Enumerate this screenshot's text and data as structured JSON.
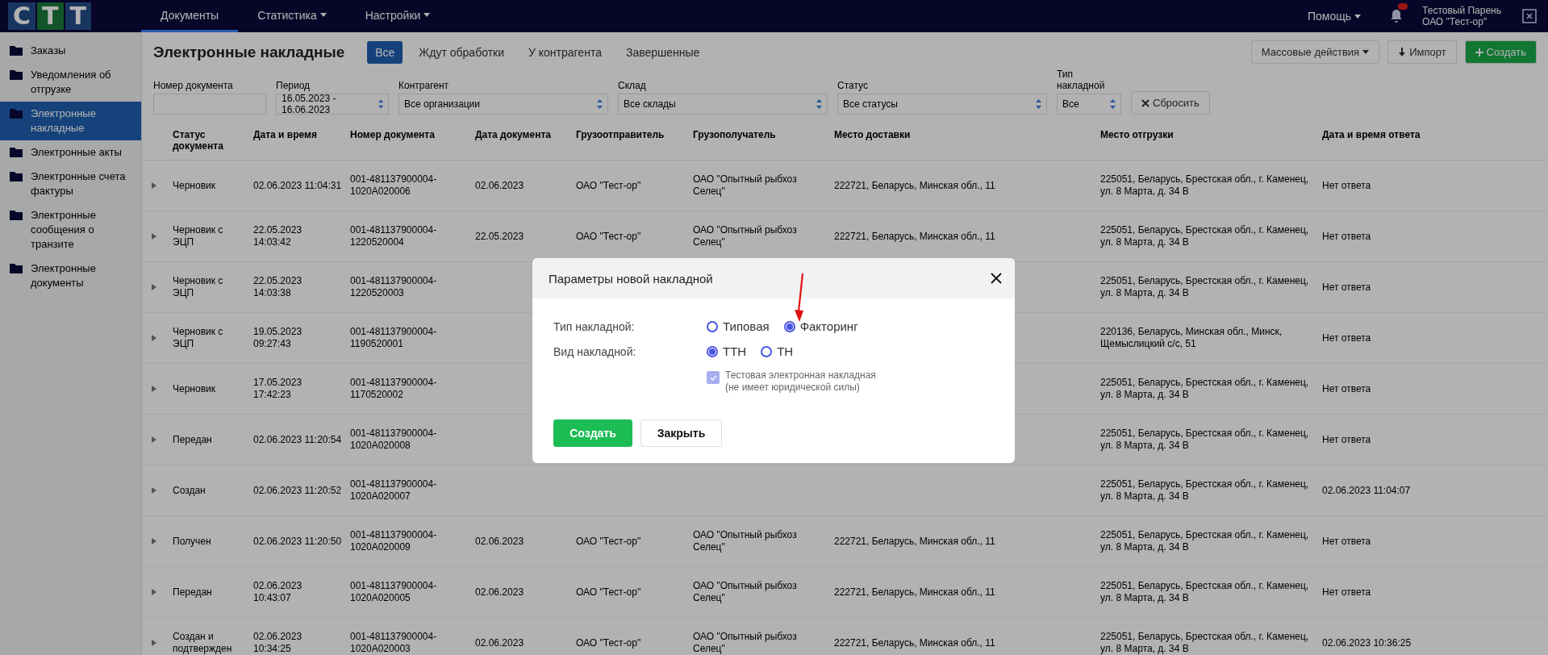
{
  "topbar": {
    "logo": [
      "С",
      "Т",
      "Т"
    ],
    "nav": [
      {
        "label": "Документы",
        "selected": true,
        "dropdown": false
      },
      {
        "label": "Статистика",
        "selected": false,
        "dropdown": true
      },
      {
        "label": "Настройки",
        "selected": false,
        "dropdown": true
      }
    ],
    "help": "Помощь",
    "user": {
      "name": "Тестовый Парень",
      "org": "ОАО \"Тест-ор\""
    }
  },
  "sidebar": {
    "items": [
      {
        "label": "Заказы",
        "selected": false
      },
      {
        "label": "Уведомления об отгрузке",
        "selected": false
      },
      {
        "label": "Электронные накладные",
        "selected": true
      },
      {
        "label": "Электронные акты",
        "selected": false
      },
      {
        "label": "Электронные счета фактуры",
        "selected": false
      },
      {
        "label": "Электронные сообщения о транзите",
        "selected": false
      },
      {
        "label": "Электронные документы",
        "selected": false
      }
    ]
  },
  "header": {
    "title": "Электронные накладные",
    "tabs": [
      {
        "label": "Все",
        "selected": true
      },
      {
        "label": "Ждут обработки",
        "selected": false
      },
      {
        "label": "У контрагента",
        "selected": false
      },
      {
        "label": "Завершенные",
        "selected": false
      }
    ],
    "mass_actions": "Массовые действия",
    "import": "Импорт",
    "create": "Создать"
  },
  "filters": [
    {
      "label": "Номер документа",
      "kind": "input"
    },
    {
      "label": "Период",
      "value": "16.05.2023 - 16.06.2023",
      "kind": "select"
    },
    {
      "label": "Контрагент",
      "value": "Все организации",
      "kind": "select"
    },
    {
      "label": "Склад",
      "value": "Все склады",
      "kind": "select"
    },
    {
      "label": "Статус",
      "value": "Все статусы",
      "kind": "select"
    },
    {
      "label": "Тип накладной",
      "value": "Все",
      "kind": "select"
    }
  ],
  "reset": "Сбросить",
  "table": {
    "columns": [
      "Статус документа",
      "Дата и время",
      "Номер документа",
      "Дата документа",
      "Грузоотправитель",
      "Грузополучатель",
      "Место доставки",
      "Место отгрузки",
      "Дата и время ответа"
    ],
    "rows": [
      {
        "status": "Черновик",
        "datetime": "02.06.2023 11:04:31",
        "number": "001-481137900004-1020А020006",
        "doc_date": "02.06.2023",
        "sender": "ОАО \"Тест-ор\"",
        "recipient": "ОАО \"Опытный рыбхоз Селец\"",
        "delivery": "222721, Беларусь, Минская обл., 11",
        "shipping": "225051, Беларусь, Брестская обл., г. Каменец, ул. 8 Марта, д. 34 В",
        "reply": "Нет ответа"
      },
      {
        "status": "Черновик с ЭЦП",
        "datetime": "22.05.2023 14:03:42",
        "number": "001-481137900004-1220520004",
        "doc_date": "22.05.2023",
        "sender": "ОАО \"Тест-ор\"",
        "recipient": "ОАО \"Опытный рыбхоз Селец\"",
        "delivery": "222721, Беларусь, Минская обл., 11",
        "shipping": "225051, Беларусь, Брестская обл., г. Каменец, ул. 8 Марта, д. 34 В",
        "reply": "Нет ответа"
      },
      {
        "status": "Черновик с ЭЦП",
        "datetime": "22.05.2023 14:03:38",
        "number": "001-481137900004-1220520003",
        "shipping": "225051, Беларусь, Брестская обл., г. Каменец, ул. 8 Марта, д. 34 В",
        "reply": "Нет ответа"
      },
      {
        "status": "Черновик с ЭЦП",
        "datetime": "19.05.2023 09:27:43",
        "number": "001-481137900004-1190520001",
        "shipping": "220136, Беларусь, Минская обл., Минск, Щемыслицкий с/с, 51",
        "reply": "Нет ответа"
      },
      {
        "status": "Черновик",
        "datetime": "17.05.2023 17:42:23",
        "number": "001-481137900004-1170520002",
        "shipping": "225051, Беларусь, Брестская обл., г. Каменец, ул. 8 Марта, д. 34 В",
        "reply": "Нет ответа"
      },
      {
        "status": "Передан",
        "datetime": "02.06.2023 11:20:54",
        "number": "001-481137900004-1020А020008",
        "shipping": "225051, Беларусь, Брестская обл., г. Каменец, ул. 8 Марта, д. 34 В",
        "reply": "Нет ответа"
      },
      {
        "status": "Создан",
        "datetime": "02.06.2023 11:20:52",
        "number": "001-481137900004-1020А020007",
        "shipping": "225051, Беларусь, Брестская обл., г. Каменец, ул. 8 Марта, д. 34 В",
        "reply": "02.06.2023 11:04:07"
      },
      {
        "status": "Получен",
        "datetime": "02.06.2023 11:20:50",
        "number": "001-481137900004-1020А020009",
        "doc_date": "02.06.2023",
        "sender": "ОАО \"Тест-ор\"",
        "recipient": "ОАО \"Опытный рыбхоз Селец\"",
        "delivery": "222721, Беларусь, Минская обл., 11",
        "shipping": "225051, Беларусь, Брестская обл., г. Каменец, ул. 8 Марта, д. 34 В",
        "reply": "Нет ответа"
      },
      {
        "status": "Передан",
        "datetime": "02.06.2023 10:43:07",
        "number": "001-481137900004-1020А020005",
        "doc_date": "02.06.2023",
        "sender": "ОАО \"Тест-ор\"",
        "recipient": "ОАО \"Опытный рыбхоз Селец\"",
        "delivery": "222721, Беларусь, Минская обл., 11",
        "shipping": "225051, Беларусь, Брестская обл., г. Каменец, ул. 8 Марта, д. 34 В",
        "reply": "Нет ответа"
      },
      {
        "status": "Создан и подтвержден",
        "datetime": "02.06.2023 10:34:25",
        "number": "001-481137900004-1020А020003",
        "doc_date": "02.06.2023",
        "sender": "ОАО \"Тест-ор\"",
        "recipient": "ОАО \"Опытный рыбхоз Селец\"",
        "delivery": "222721, Беларусь, Минская обл., 11",
        "shipping": "225051, Беларусь, Брестская обл., г. Каменец, ул. 8 Марта, д. 34 В",
        "reply": "02.06.2023 10:36:25"
      }
    ]
  },
  "dialog": {
    "title": "Параметры новой накладной",
    "groups": [
      {
        "label": "Тип накладной:",
        "options": [
          {
            "label": "Типовая",
            "selected": false
          },
          {
            "label": "Факторинг",
            "selected": true
          }
        ]
      },
      {
        "label": "Вид накладной:",
        "options": [
          {
            "label": "ТТН",
            "selected": true
          },
          {
            "label": "ТН",
            "selected": false
          }
        ]
      }
    ],
    "test_checkbox": {
      "lines": [
        "Тестовая электронная накладная",
        "(не имеет юридической силы)"
      ],
      "checked": true,
      "disabled": true
    },
    "buttons": [
      {
        "label": "Создать",
        "kind": "primary"
      },
      {
        "label": "Закрыть",
        "kind": "secondary"
      }
    ]
  }
}
